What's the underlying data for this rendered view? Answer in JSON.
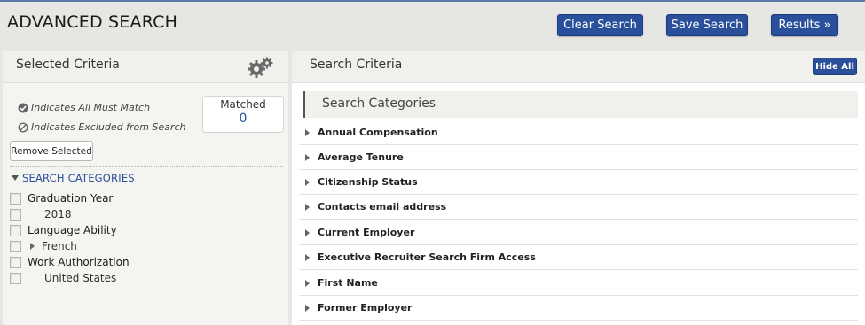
{
  "page": {
    "title": "ADVANCED SEARCH"
  },
  "toolbar": {
    "clear_label": "Clear Search",
    "save_label": "Save Search",
    "results_label": "Results »"
  },
  "left": {
    "title": "Selected Criteria",
    "legend_all_must_match": "Indicates All Must Match",
    "legend_excluded": "Indicates Excluded from Search",
    "matched_label": "Matched",
    "matched_value": "0",
    "remove_label": "Remove Selected",
    "categories_heading": "SEARCH CATEGORIES",
    "criteria": [
      {
        "label": "Graduation Year"
      },
      {
        "label": "2018"
      },
      {
        "label": "Language Ability"
      },
      {
        "label": "French"
      },
      {
        "label": "Work Authorization"
      },
      {
        "label": "United States"
      }
    ]
  },
  "right": {
    "title": "Search Criteria",
    "hide_all_label": "Hide All",
    "categories_title": "Search Categories",
    "categories": [
      "Annual Compensation",
      "Average Tenure",
      "Citizenship Status",
      "Contacts email address",
      "Current Employer",
      "Executive Recruiter Search Firm Access",
      "First Name",
      "Former Employer"
    ]
  },
  "colors": {
    "accent": "#2a4f9b",
    "background": "#e6e6e3"
  }
}
